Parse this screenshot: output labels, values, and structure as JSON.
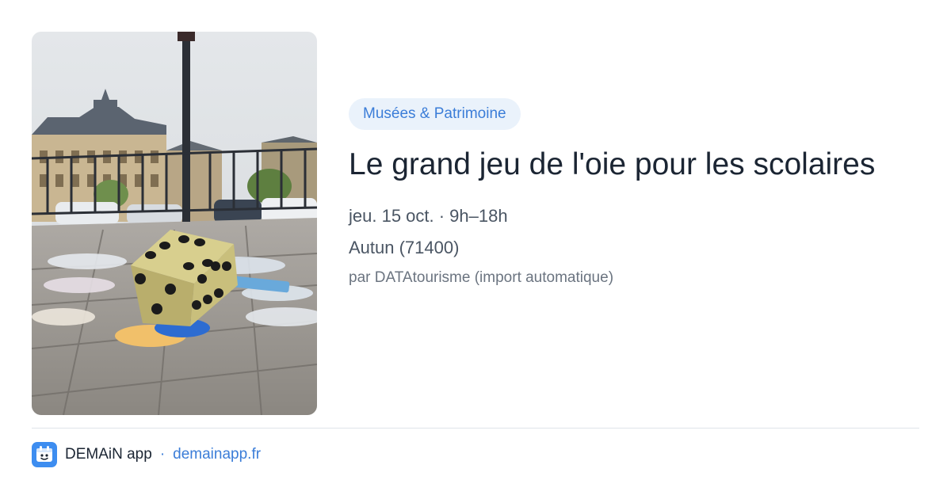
{
  "event": {
    "category": "Musées & Patrimoine",
    "title": "Le grand jeu de l'oie pour les scolaires",
    "datetime": "jeu. 15 oct. · 9h–18h",
    "location": "Autun (71400)",
    "source": "par DATAtourisme (import automatique)"
  },
  "footer": {
    "app_name": "DEMAiN app",
    "separator": "·",
    "domain": "demainapp.fr",
    "app_icon": "calendar-icon"
  },
  "colors": {
    "accent": "#3b7dd8",
    "badge_bg": "#eaf2fb",
    "title": "#1b2533",
    "app_icon_bg": "#3d8df0"
  }
}
